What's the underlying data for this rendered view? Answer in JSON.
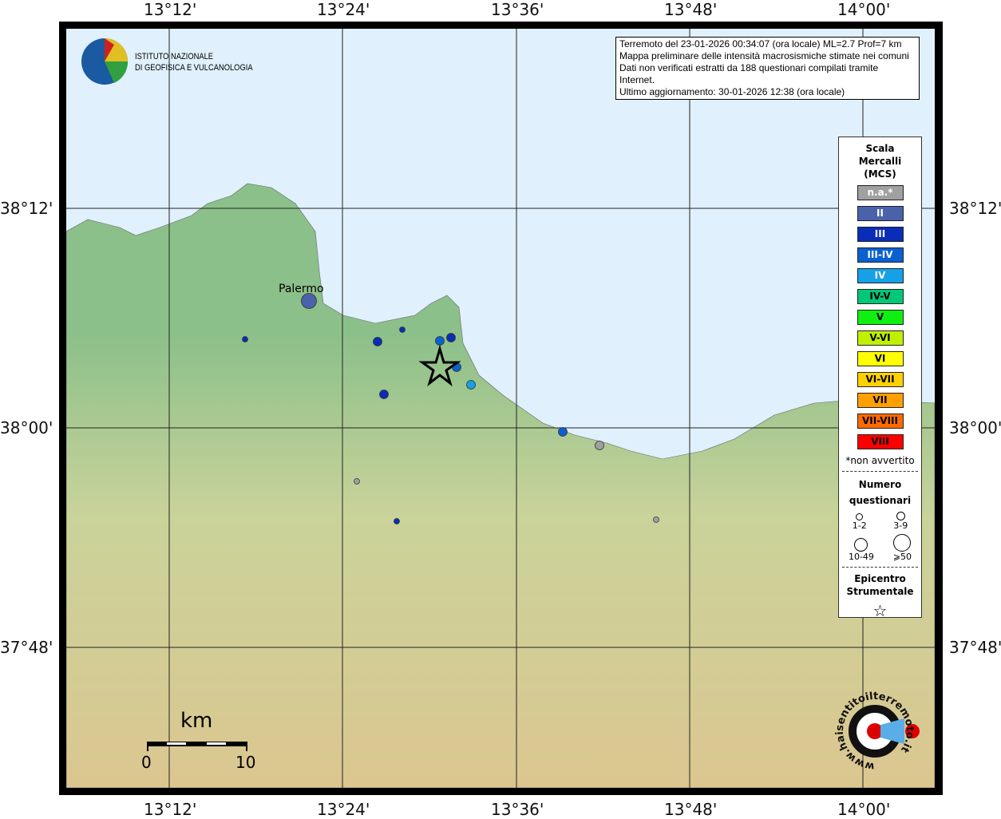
{
  "map": {
    "lon_labels": [
      "13°12'",
      "13°24'",
      "13°36'",
      "13°48'",
      "14°00'"
    ],
    "lat_labels": [
      "38°12'",
      "38°00'",
      "37°48'"
    ],
    "city": "Palermo",
    "logo_text": [
      "ISTITUTO NAZIONALE",
      "DI GEOFISICA E VULCANOLOGIA"
    ],
    "site_logo": "www.haisentitoilterremoto.it",
    "scale": {
      "unit": "km",
      "min": "0",
      "max": "10"
    }
  },
  "info": [
    "Terremoto del 23-01-2026 00:34:07 (ora locale) ML=2.7 Prof=7 km",
    "Mappa preliminare delle intensità macrosismiche stimate nei comuni",
    "Dati non verificati estratti da 188 questionari compilati tramite Internet.",
    "Ultimo aggiornamento: 30-01-2026 12:38 (ora locale)"
  ],
  "legend": {
    "title": [
      "Scala",
      "Mercalli",
      "(MCS)"
    ],
    "classes": [
      {
        "label": "n.a.*",
        "color": "#a0a0a0",
        "text": "#fff"
      },
      {
        "label": "II",
        "color": "#4a62aa",
        "text": "#fff"
      },
      {
        "label": "III",
        "color": "#0a2db8",
        "text": "#fff"
      },
      {
        "label": "III-IV",
        "color": "#0a60d0",
        "text": "#fff"
      },
      {
        "label": "IV",
        "color": "#16a0e8",
        "text": "#fff"
      },
      {
        "label": "IV-V",
        "color": "#00c878",
        "text": "#000"
      },
      {
        "label": "V",
        "color": "#10f010",
        "text": "#000"
      },
      {
        "label": "V-VI",
        "color": "#c0f000",
        "text": "#000"
      },
      {
        "label": "VI",
        "color": "#ffff00",
        "text": "#000"
      },
      {
        "label": "VI-VII",
        "color": "#ffd000",
        "text": "#000"
      },
      {
        "label": "VII",
        "color": "#ffa000",
        "text": "#000"
      },
      {
        "label": "VII-VIII",
        "color": "#ff6a00",
        "text": "#000"
      },
      {
        "label": "VIII",
        "color": "#ff0000",
        "text": "#000"
      }
    ],
    "note": "*non avvertito",
    "count_title": [
      "Numero",
      "questionari"
    ],
    "counts": [
      "1-2",
      "3-9",
      "10-49",
      "⩾50"
    ],
    "epi_title": [
      "Epicentro",
      "Strumentale"
    ]
  },
  "points": [
    {
      "cls": "II",
      "n": "10-49"
    },
    {
      "cls": "III",
      "n": "1-2"
    },
    {
      "cls": "III",
      "n": "3-9"
    },
    {
      "cls": "III",
      "n": "1-2"
    },
    {
      "cls": "III-IV",
      "n": "3-9"
    },
    {
      "cls": "III",
      "n": "3-9"
    },
    {
      "cls": "III-IV",
      "n": "3-9"
    },
    {
      "cls": "IV",
      "n": "3-9"
    },
    {
      "cls": "III",
      "n": "3-9"
    },
    {
      "cls": "III-IV",
      "n": "3-9"
    },
    {
      "cls": "n.a.*",
      "n": "3-9"
    },
    {
      "cls": "n.a.*",
      "n": "1-2"
    },
    {
      "cls": "III",
      "n": "1-2"
    },
    {
      "cls": "n.a.*",
      "n": "1-2"
    }
  ]
}
